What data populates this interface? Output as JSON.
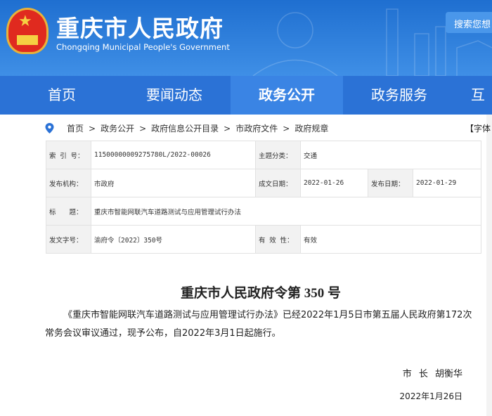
{
  "header": {
    "title": "重庆市人民政府",
    "subtitle": "Chongqing Municipal People's Government",
    "search_label": "搜索您想"
  },
  "nav": [
    {
      "label": "首页"
    },
    {
      "label": "要闻动态"
    },
    {
      "label": "政务公开",
      "active": true
    },
    {
      "label": "政务服务"
    },
    {
      "label": "互"
    }
  ],
  "breadcrumb": [
    "首页",
    "政务公开",
    "政府信息公开目录",
    "市政府文件",
    "政府规章"
  ],
  "breadcrumb_sep": ">",
  "font_size_label": "【字体",
  "meta": {
    "index_label": "索 引 号：",
    "index": "11500000009275780L/2022-00026",
    "topic_label": "主题分类：",
    "topic": "交通",
    "issuer_label": "发布机构：",
    "issuer": "市政府",
    "written_label": "成文日期：",
    "written": "2022-01-26",
    "published_label": "发布日期：",
    "published": "2022-01-29",
    "title_label": "标　　题：",
    "title": "重庆市智能网联汽车道路测试与应用管理试行办法",
    "docno_label": "发文字号：",
    "docno": "渝府令〔2022〕350号",
    "validity_label": "有 效 性：",
    "validity": "有效"
  },
  "doc": {
    "heading": "重庆市人民政府令第 350 号",
    "body": "《重庆市智能网联汽车道路测试与应用管理试行办法》已经2022年1月5日市第五届人民政府第172次常务会议审议通过，现予公布，自2022年3月1日起施行。",
    "signature": "市 长 胡衡华",
    "date": "2022年1月26日"
  }
}
